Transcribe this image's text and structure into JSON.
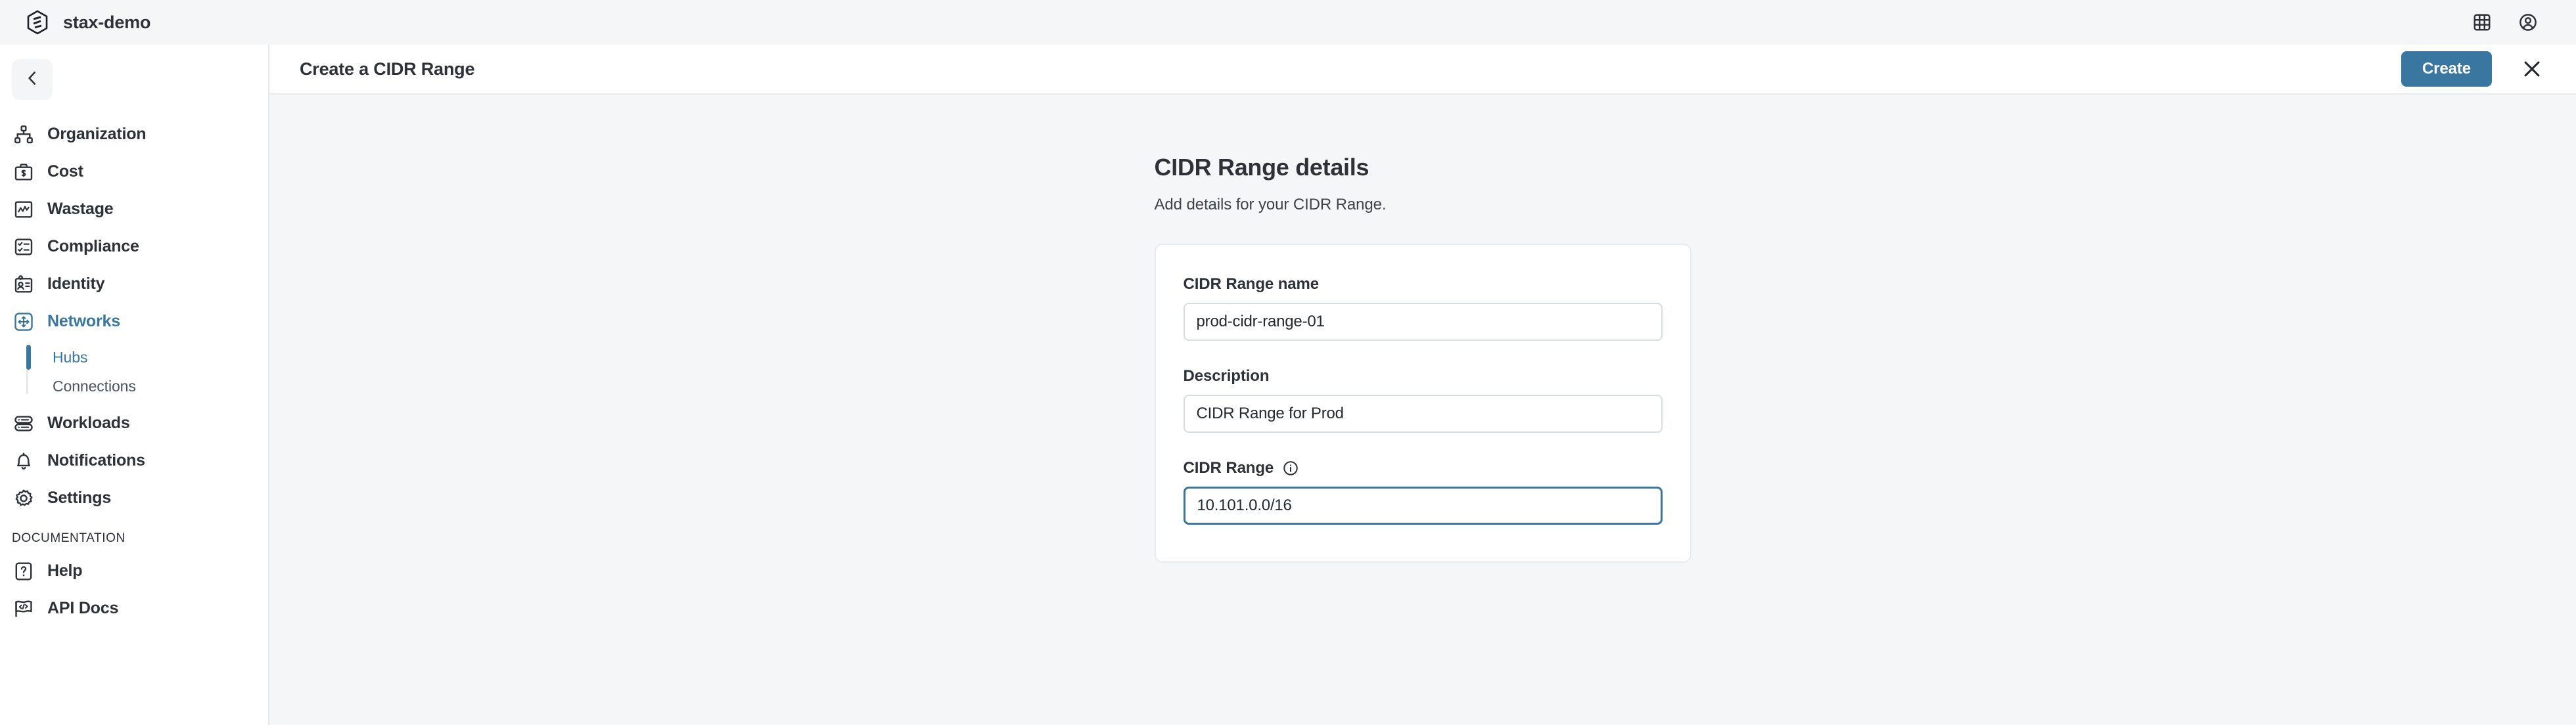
{
  "topbar": {
    "brand_name": "stax-demo",
    "logo_icon": "stax-hex-logo-icon",
    "apps_icon": "grid-apps-icon",
    "account_icon": "user-circle-icon"
  },
  "sidebar": {
    "back_icon": "chevron-left-icon",
    "items": [
      {
        "label": "Organization",
        "icon": "org-chart-icon",
        "active": false
      },
      {
        "label": "Cost",
        "icon": "briefcase-dollar-icon",
        "active": false
      },
      {
        "label": "Wastage",
        "icon": "chart-box-icon",
        "active": false
      },
      {
        "label": "Compliance",
        "icon": "checklist-icon",
        "active": false
      },
      {
        "label": "Identity",
        "icon": "id-card-icon",
        "active": false
      },
      {
        "label": "Networks",
        "icon": "network-arrows-icon",
        "active": true
      },
      {
        "label": "Workloads",
        "icon": "server-stack-icon",
        "active": false
      },
      {
        "label": "Notifications",
        "icon": "bell-icon",
        "active": false
      },
      {
        "label": "Settings",
        "icon": "gear-icon",
        "active": false
      }
    ],
    "networks_subitems": [
      {
        "label": "Hubs",
        "active": true
      },
      {
        "label": "Connections",
        "active": false
      }
    ],
    "documentation_title": "DOCUMENTATION",
    "documentation_items": [
      {
        "label": "Help",
        "icon": "question-box-icon"
      },
      {
        "label": "API Docs",
        "icon": "code-flag-icon"
      }
    ]
  },
  "panel": {
    "title": "Create a CIDR Range",
    "create_label": "Create",
    "close_icon": "close-x-icon"
  },
  "main": {
    "heading": "CIDR Range details",
    "subheading": "Add details for your CIDR Range.",
    "fields": [
      {
        "label": "CIDR Range name",
        "value": "prod-cidr-range-01",
        "placeholder": "CIDR Range name",
        "focused": false,
        "has_info": false
      },
      {
        "label": "Description",
        "value": "CIDR Range for Prod",
        "placeholder": "Description",
        "focused": false,
        "has_info": false
      },
      {
        "label": "CIDR Range",
        "value": "10.101.0.0/16",
        "placeholder": "CIDR Range",
        "focused": true,
        "has_info": true,
        "info_icon": "info-circle-icon"
      }
    ]
  },
  "colors": {
    "accent": "#3a77a0",
    "text": "#2e3238",
    "page_bg": "#f5f6f8",
    "card_bg": "#ffffff",
    "border": "#e6e9ee"
  }
}
